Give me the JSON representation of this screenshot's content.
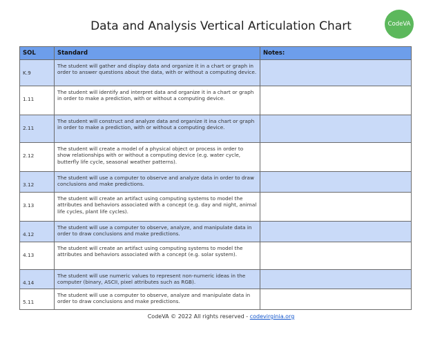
{
  "title": "Data and Analysis Vertical Articulation Chart",
  "logo": {
    "text": "CodeVA",
    "color": "#5cb85c"
  },
  "table": {
    "header_color": "#6d9eeb",
    "shade_color": "#c9daf8",
    "headers": {
      "sol": "SOL",
      "standard": "Standard",
      "notes": "Notes:"
    },
    "rows": [
      {
        "sol": "K.9",
        "standard": "The student will gather and display data and organize it in a chart or graph in order to answer questions about the data, with or without a computing device.",
        "notes": "",
        "shaded": true
      },
      {
        "sol": "1.11",
        "standard": "The student will identify and interpret data and organize it in a chart or graph in order to make a prediction, with or without a computing device.",
        "notes": "",
        "shaded": false
      },
      {
        "sol": "2.11",
        "standard": "The student will construct and analyze data and organize it ina chart or graph in order to make a prediction, with or without a computing device.",
        "notes": "",
        "shaded": true
      },
      {
        "sol": "2.12",
        "standard": "The student will create a model of a physical object or process in order to show relationships with or without a computing device (e.g. water cycle, butterfly life cycle, seasonal weather patterns).",
        "notes": "",
        "shaded": false
      },
      {
        "sol": "3.12",
        "standard": "The student will use a computer to observe and analyze data in order to draw conclusions and make predictions.",
        "notes": "",
        "shaded": true
      },
      {
        "sol": "3.13",
        "standard": "The student will create an artifact using computing systems to model the attributes and behaviors associated with a concept (e.g. day and night, animal life cycles, plant life cycles).",
        "notes": "",
        "shaded": false
      },
      {
        "sol": "4.12",
        "standard": "The student will use a computer to observe, analyze, and manipulate data in order to draw conclusions and make predictions.",
        "notes": "",
        "shaded": true
      },
      {
        "sol": "4.13",
        "standard": "The student will create an artifact using computing systems to model the attributes and behaviors associated with a concept (e.g. solar system).",
        "notes": "",
        "shaded": false
      },
      {
        "sol": "4.14",
        "standard": "The student will use numeric values to represent non-numeric ideas in the computer (binary, ASCII, pixel attributes such as RGB).",
        "notes": "",
        "shaded": true
      },
      {
        "sol": "5.11",
        "standard": "The student will use a computer to observe, analyze and manipulate data in order to draw conclusions and make predictions.",
        "notes": "",
        "shaded": false
      }
    ]
  },
  "footer": {
    "text": "CodeVA © 2022 All rights reserved - ",
    "link": "codevirginia.org"
  }
}
